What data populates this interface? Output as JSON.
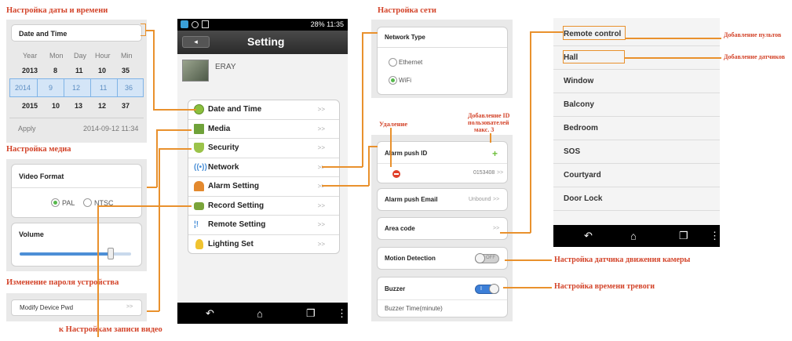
{
  "captions": {
    "datetime": "Настройка даты и времени",
    "media": "Настройка медиа",
    "password": "Изменение пароля устройства",
    "record": "к Настройкам записи видео",
    "network": "Настройка сети",
    "delete": "Удаление",
    "add_id": [
      "Добавление ID",
      "пользователей",
      "макс. 3"
    ],
    "remotes": "Добавление пультов",
    "sensors": "Добавление датчиков",
    "motion": "Настройка датчика движения камеры",
    "alarm_time": "Настройка времени тревоги"
  },
  "datetime_panel": {
    "title": "Date and Time",
    "headers": [
      "Year",
      "Mon",
      "Day",
      "Hour",
      "Min"
    ],
    "rows": [
      [
        "2013",
        "8",
        "11",
        "10",
        "35"
      ],
      [
        "2014",
        "9",
        "12",
        "11",
        "36"
      ],
      [
        "2015",
        "10",
        "13",
        "12",
        "37"
      ]
    ],
    "apply_label": "Apply",
    "apply_value": "2014-09-12 11:34"
  },
  "media_panel": {
    "video_title": "Video Format",
    "options": [
      "PAL",
      "NTSC"
    ],
    "selected": "PAL",
    "volume_title": "Volume",
    "volume_level": 0.82
  },
  "password_panel": {
    "label": "Modify Device Pwd",
    "chevron": ">>"
  },
  "phone": {
    "status_right": "28% 11:35",
    "title": "Setting",
    "device_name": "ERAY",
    "menu": [
      {
        "label": "Date and Time",
        "icon": "clock-icon"
      },
      {
        "label": "Media",
        "icon": "film-icon"
      },
      {
        "label": "Security",
        "icon": "shield-icon"
      },
      {
        "label": "Network",
        "icon": "antenna-icon"
      },
      {
        "label": "Alarm Setting",
        "icon": "bell-icon"
      },
      {
        "label": "Record Setting",
        "icon": "camera-icon"
      },
      {
        "label": "Remote Setting",
        "icon": "remote-icon"
      },
      {
        "label": "Lighting Set",
        "icon": "bulb-icon"
      }
    ],
    "chevron": ">>"
  },
  "network_panel": {
    "title": "Network Type",
    "options": [
      "Ethernet",
      "WiFi"
    ],
    "selected": "WiFi"
  },
  "alarm_panel": {
    "push_id_label": "Alarm push ID",
    "push_id_value": "0153408",
    "push_email_label": "Alarm push Email",
    "push_email_value": "Unbound",
    "area_code_label": "Area code",
    "motion_label": "Motion Detection",
    "motion_state": "OFF",
    "buzzer_label": "Buzzer",
    "buzzer_state": "I",
    "buzzer_time_label": "Buzzer Time(minute)",
    "chevron": ">>"
  },
  "remote_list": {
    "items": [
      "Remote control",
      "Hall",
      "Window",
      "Balcony",
      "Bedroom",
      "SOS",
      "Courtyard",
      "Door Lock"
    ]
  },
  "colors": {
    "caption": "#d3442a",
    "connector": "#e9912d",
    "accent_green": "#56b84c",
    "toggle_blue": "#3c7fd8"
  }
}
